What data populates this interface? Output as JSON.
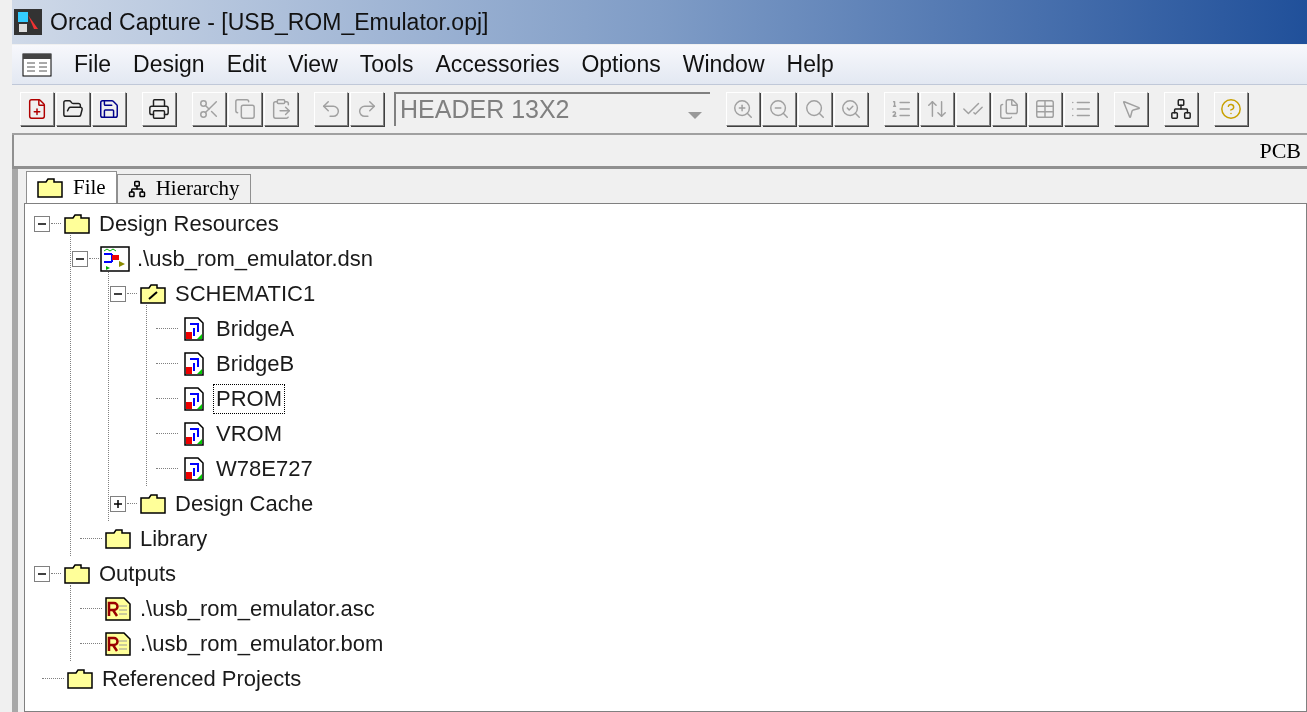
{
  "window": {
    "title": "Orcad Capture - [USB_ROM_Emulator.opj]"
  },
  "menu": [
    "File",
    "Design",
    "Edit",
    "View",
    "Tools",
    "Accessories",
    "Options",
    "Window",
    "Help"
  ],
  "toolbar": [
    {
      "kind": "new",
      "disabled": false
    },
    {
      "kind": "open",
      "disabled": false
    },
    {
      "kind": "save",
      "disabled": false
    },
    {
      "kind": "sep"
    },
    {
      "kind": "print",
      "disabled": false
    },
    {
      "kind": "sep"
    },
    {
      "kind": "cut",
      "disabled": true
    },
    {
      "kind": "copy",
      "disabled": true
    },
    {
      "kind": "paste",
      "disabled": true
    },
    {
      "kind": "sep"
    },
    {
      "kind": "undo",
      "disabled": true
    },
    {
      "kind": "redo",
      "disabled": true
    },
    {
      "kind": "combo",
      "value": "HEADER 13X2",
      "disabled": true
    },
    {
      "kind": "zoom-in",
      "disabled": true
    },
    {
      "kind": "zoom-out",
      "disabled": true
    },
    {
      "kind": "zoom-area",
      "disabled": true
    },
    {
      "kind": "zoom-all",
      "disabled": true
    },
    {
      "kind": "sep"
    },
    {
      "kind": "annotate",
      "disabled": true
    },
    {
      "kind": "back-annotate",
      "disabled": true
    },
    {
      "kind": "drc",
      "disabled": true
    },
    {
      "kind": "netlist",
      "disabled": true
    },
    {
      "kind": "cross-ref",
      "disabled": true
    },
    {
      "kind": "bom",
      "disabled": true
    },
    {
      "kind": "sep"
    },
    {
      "kind": "select",
      "disabled": true
    },
    {
      "kind": "sep"
    },
    {
      "kind": "hierarchy",
      "disabled": false
    },
    {
      "kind": "sep"
    },
    {
      "kind": "help",
      "disabled": false
    }
  ],
  "status_strip": {
    "text": "PCB"
  },
  "tabs": [
    {
      "label": "File",
      "kind": "folder",
      "selected": true
    },
    {
      "label": "Hierarchy",
      "kind": "hierarchy",
      "selected": false
    }
  ],
  "tree": [
    {
      "label": "Design Resources",
      "kind": "folder",
      "expanded": true,
      "selected": false,
      "children": [
        {
          "label": ".\\usb_rom_emulator.dsn",
          "kind": "design",
          "expanded": true,
          "selected": false,
          "children": [
            {
              "label": "SCHEMATIC1",
              "kind": "schematic",
              "expanded": true,
              "selected": false,
              "children": [
                {
                  "label": "BridgeA",
                  "kind": "page",
                  "selected": false
                },
                {
                  "label": "BridgeB",
                  "kind": "page",
                  "selected": false
                },
                {
                  "label": "PROM",
                  "kind": "page",
                  "selected": true
                },
                {
                  "label": "VROM",
                  "kind": "page",
                  "selected": false
                },
                {
                  "label": "W78E727",
                  "kind": "page",
                  "selected": false
                }
              ]
            },
            {
              "label": "Design Cache",
              "kind": "folder",
              "expanded": false,
              "selected": false
            }
          ]
        },
        {
          "label": "Library",
          "kind": "folder",
          "selected": false
        }
      ]
    },
    {
      "label": "Outputs",
      "kind": "folder",
      "expanded": true,
      "selected": false,
      "children": [
        {
          "label": ".\\usb_rom_emulator.asc",
          "kind": "report",
          "selected": false
        },
        {
          "label": ".\\usb_rom_emulator.bom",
          "kind": "report",
          "selected": false
        }
      ]
    },
    {
      "label": "Referenced Projects",
      "kind": "folder",
      "selected": false
    }
  ]
}
